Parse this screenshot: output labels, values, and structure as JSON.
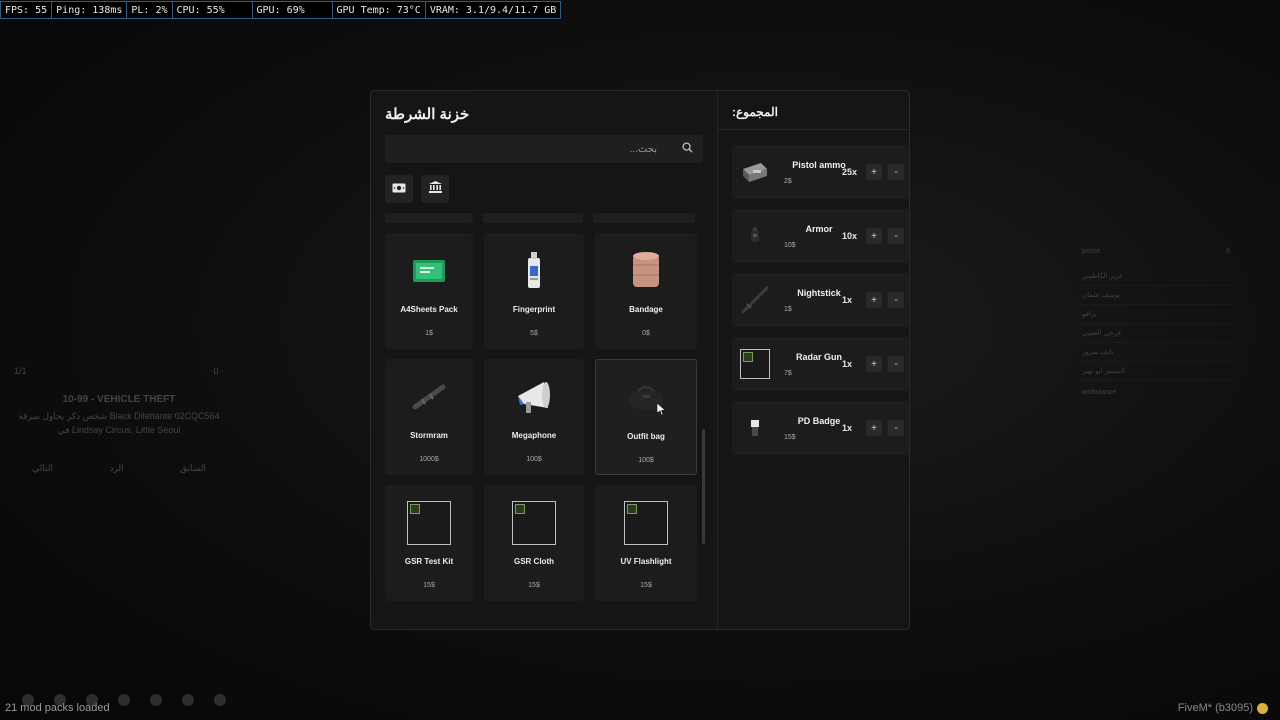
{
  "perf": {
    "fps": "FPS: 55",
    "ping": "Ping: 138ms",
    "pl": "PL: 2%",
    "cpu": "CPU: 55%",
    "gpu": "GPU: 69%",
    "gpu_temp": "GPU Temp: 73°C",
    "vram": "VRAM: 3.1/9.4/11.7 GB"
  },
  "background": {
    "call": {
      "count": "1/1",
      "code": "10-99 - VEHICLE THEFT",
      "desc": "شخص ذكر يحاول سرقة Black Dilettante 02CQC564 في Lindsay Circus, Little Seoul",
      "prev": "السابق",
      "reply": "الرد",
      "next": "التالي"
    },
    "list": {
      "header": "police",
      "footer": "ambulance",
      "rows": [
        "عزيز الكاظمي",
        "يوسف عثمان",
        "برافو",
        "فرحي العتيبي",
        "نايف سرور",
        "المستر ابو نهير"
      ]
    },
    "mods": "21 mod packs loaded",
    "build": "FiveM* (b3095)"
  },
  "shop": {
    "title": "خزنة الشرطة",
    "search_placeholder": "بحث...",
    "tabs": [
      {
        "icon": "cash-icon"
      },
      {
        "icon": "bank-icon"
      }
    ],
    "items": [
      {
        "name": "A4Sheets Pack",
        "price": "1$",
        "icon": "paper-pack-icon"
      },
      {
        "name": "Fingerprint",
        "price": "5$",
        "icon": "fingerprint-kit-icon"
      },
      {
        "name": "Bandage",
        "price": "0$",
        "icon": "bandage-icon"
      },
      {
        "name": "Stormram",
        "price": "1000$",
        "icon": "stormram-icon"
      },
      {
        "name": "Megaphone",
        "price": "100$",
        "icon": "megaphone-icon"
      },
      {
        "name": "Outfit bag",
        "price": "100$",
        "icon": "duffel-bag-icon"
      },
      {
        "name": "GSR Test Kit",
        "price": "15$",
        "icon": "broken-image-icon"
      },
      {
        "name": "GSR Cloth",
        "price": "15$",
        "icon": "broken-image-icon"
      },
      {
        "name": "UV Flashlight",
        "price": "15$",
        "icon": "broken-image-icon"
      }
    ]
  },
  "cart": {
    "title": "المجموع:",
    "items": [
      {
        "name": "Pistol ammo",
        "price": "2$",
        "qty": "25x",
        "icon": "ammo-box-icon"
      },
      {
        "name": "Armor",
        "price": "10$",
        "qty": "10x",
        "icon": "armor-icon"
      },
      {
        "name": "Nightstick",
        "price": "1$",
        "qty": "1x",
        "icon": "nightstick-icon"
      },
      {
        "name": "Radar Gun",
        "price": "7$",
        "qty": "1x",
        "icon": "broken-image-icon"
      },
      {
        "name": "PD Badge",
        "price": "15$",
        "qty": "1x",
        "icon": "badge-icon"
      }
    ],
    "plus": "+",
    "minus": "-"
  }
}
